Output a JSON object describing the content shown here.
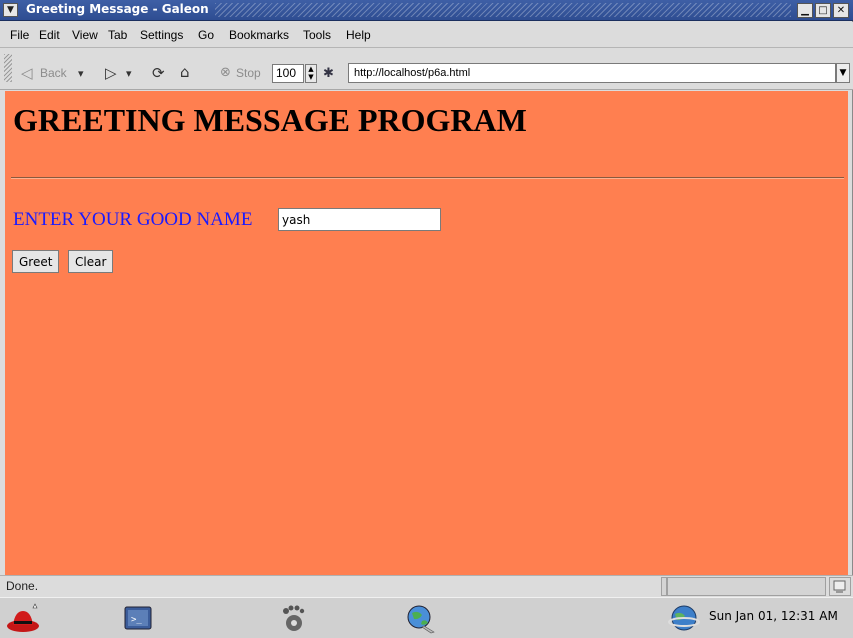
{
  "window": {
    "title": "Greeting Message - Galeon",
    "controls": [
      "minimize-icon",
      "maximize-icon",
      "close-icon"
    ]
  },
  "menubar": {
    "items": [
      {
        "label": "File"
      },
      {
        "label": "Edit"
      },
      {
        "label": "View"
      },
      {
        "label": "Tab"
      },
      {
        "label": "Settings"
      },
      {
        "label": "Go"
      },
      {
        "label": "Bookmarks"
      },
      {
        "label": "Tools"
      },
      {
        "label": "Help"
      }
    ]
  },
  "toolbar": {
    "back_label": "Back",
    "stop_label": "Stop",
    "zoom_value": "100",
    "url": "http://localhost/p6a.html"
  },
  "page": {
    "heading": "GREETING MESSAGE PROGRAM",
    "name_label": "ENTER YOUR GOOD NAME",
    "name_value": "yash",
    "greet_label": "Greet",
    "clear_label": "Clear",
    "background_color": "#ff7f50",
    "label_color": "#1a1aff"
  },
  "statusbar": {
    "text": "Done."
  },
  "panel": {
    "clock": "Sun Jan 01, 12:31 AM"
  }
}
